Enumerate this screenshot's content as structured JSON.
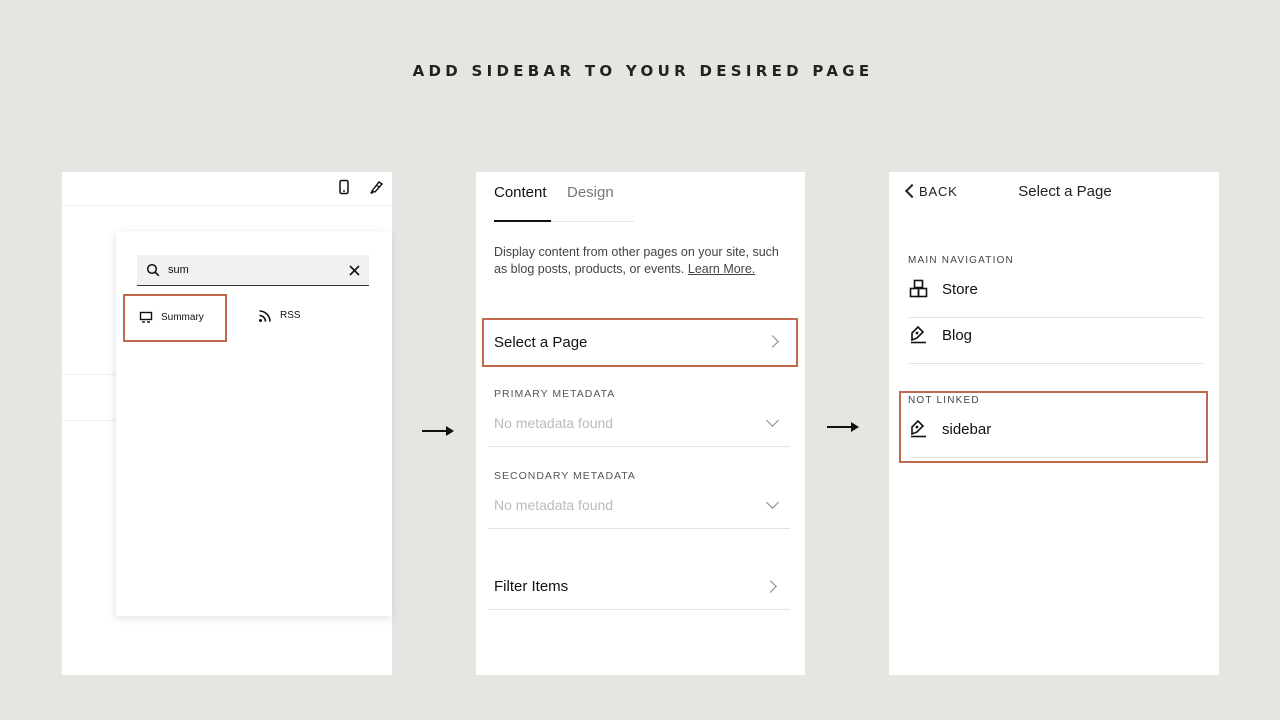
{
  "headline": "ADD SIDEBAR TO YOUR DESIRED PAGE",
  "step1": {
    "icons": [
      "mobile-icon",
      "paintbrush-icon"
    ],
    "search": {
      "value": "sum"
    },
    "blocks": [
      {
        "label": "Summary",
        "icon": "summary-block-icon",
        "highlighted": true
      },
      {
        "label": "RSS",
        "icon": "rss-icon",
        "highlighted": false
      }
    ]
  },
  "step2": {
    "tabs": [
      "Content",
      "Design"
    ],
    "active_tab": "Content",
    "description": "Display content from other pages on your site, such as blog posts, products, or events.",
    "learn_more": "Learn More.",
    "select_page": "Select a Page",
    "primary_metadata": {
      "label": "PRIMARY METADATA",
      "value": "No metadata found"
    },
    "secondary_metadata": {
      "label": "SECONDARY METADATA",
      "value": "No metadata found"
    },
    "filter_items": "Filter Items"
  },
  "step3": {
    "back": "BACK",
    "title": "Select a Page",
    "main_nav_label": "MAIN NAVIGATION",
    "main_nav_items": [
      {
        "label": "Store",
        "icon": "store-icon"
      },
      {
        "label": "Blog",
        "icon": "blog-icon"
      }
    ],
    "not_linked_label": "NOT LINKED",
    "not_linked_items": [
      {
        "label": "sidebar",
        "icon": "blog-icon"
      }
    ]
  },
  "colors": {
    "highlight": "#c0694f",
    "background": "#e6e5e2"
  }
}
